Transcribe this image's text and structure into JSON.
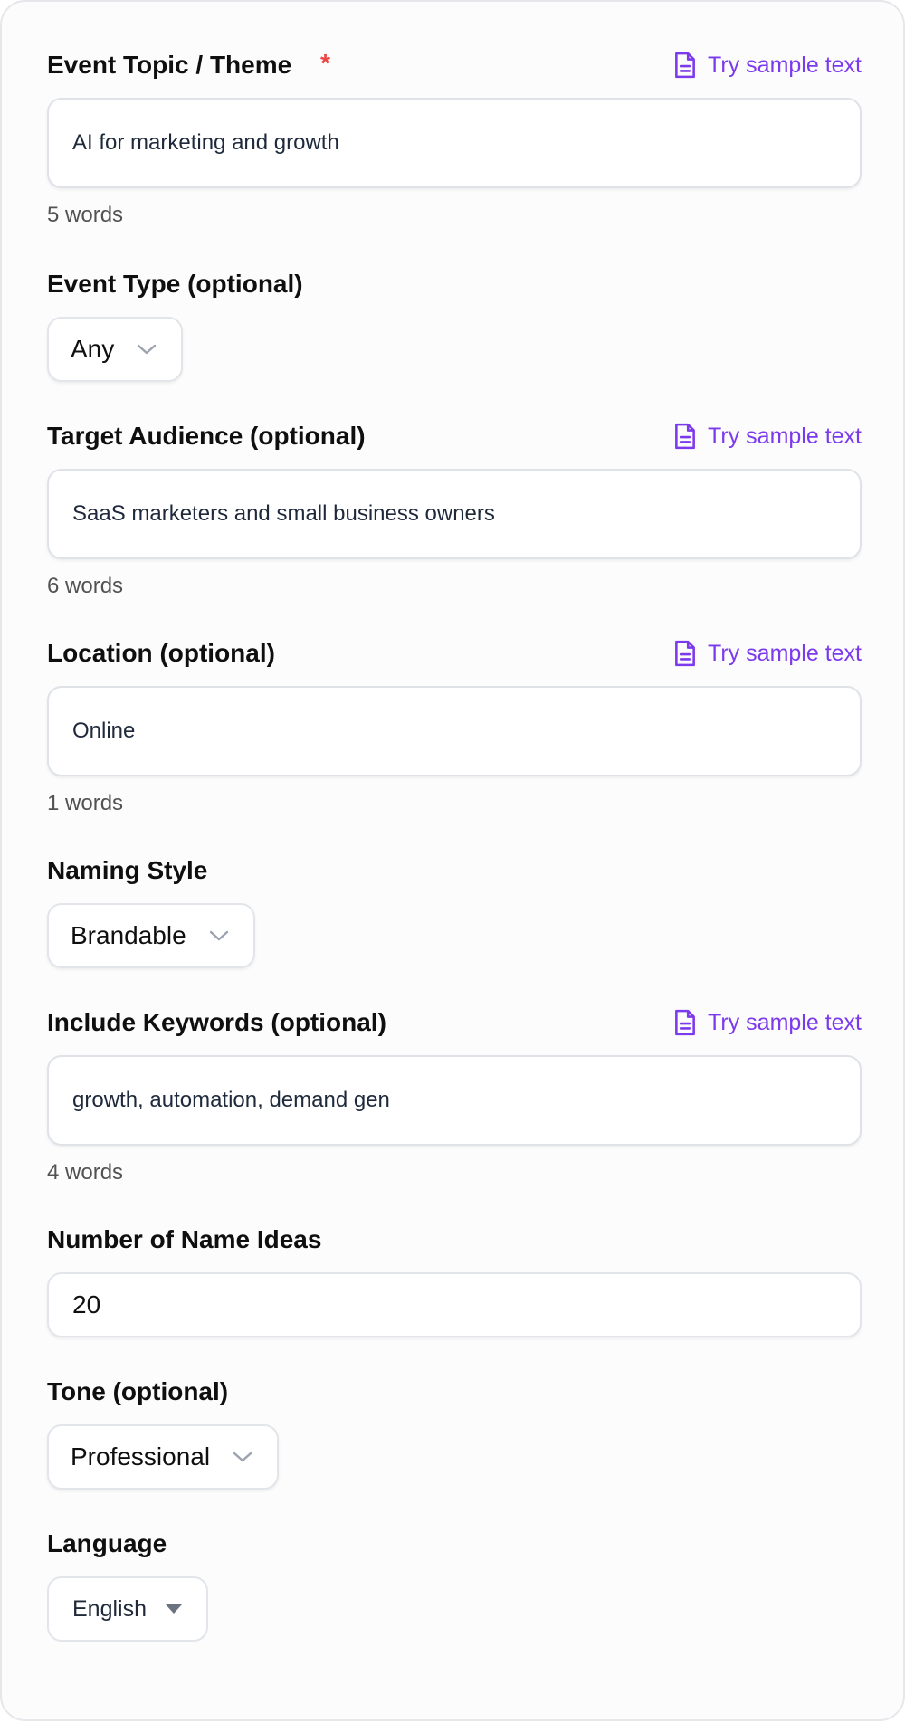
{
  "colors": {
    "accent": "#7c3aed",
    "required": "#ef4444",
    "border": "#e2e5e9"
  },
  "sample_link_label": "Try sample text",
  "sample_icon": "document-icon",
  "fields": {
    "topic": {
      "label": "Event Topic / Theme",
      "required_mark": "*",
      "value": "AI for marketing and growth",
      "counter": "5 words"
    },
    "event_type": {
      "label": "Event Type (optional)",
      "value": "Any"
    },
    "audience": {
      "label": "Target Audience (optional)",
      "value": "SaaS marketers and small business owners",
      "counter": "6 words"
    },
    "location": {
      "label": "Location (optional)",
      "value": "Online",
      "counter": "1 words"
    },
    "naming_style": {
      "label": "Naming Style",
      "value": "Brandable"
    },
    "keywords": {
      "label": "Include Keywords (optional)",
      "value": "growth, automation, demand gen",
      "counter": "4 words"
    },
    "count": {
      "label": "Number of Name Ideas",
      "value": "20"
    },
    "tone": {
      "label": "Tone (optional)",
      "value": "Professional"
    },
    "language": {
      "label": "Language",
      "value": "English"
    }
  }
}
